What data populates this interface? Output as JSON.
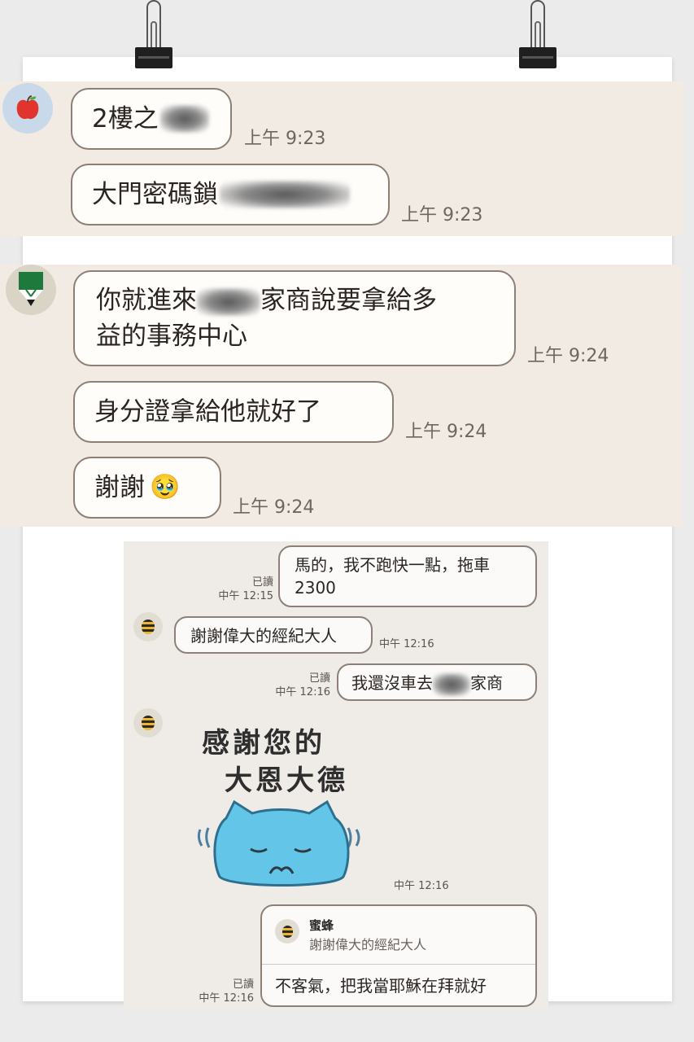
{
  "top_chat": {
    "group1": {
      "messages": [
        {
          "text": "2樓之",
          "time": "上午 9:23"
        },
        {
          "text": "大門密碼鎖",
          "time": "上午 9:23"
        }
      ]
    },
    "group2": {
      "messages": [
        {
          "text_a": "你就進來",
          "text_b": "家商說要拿給多",
          "text_c": "益的事務中心",
          "time": "上午 9:24"
        },
        {
          "text": "身分證拿給他就好了",
          "time": "上午 9:24"
        },
        {
          "text": "謝謝",
          "emoji": "🥹",
          "time": "上午 9:24"
        }
      ]
    }
  },
  "bottom_chat": {
    "msg1": {
      "line1": "馬的，我不跑快一點，拖車",
      "line2": "2300",
      "read": "已讀",
      "time": "中午 12:15"
    },
    "msg2": {
      "text": "謝謝偉大的經紀大人",
      "time": "中午 12:16"
    },
    "msg3": {
      "text_a": "我還沒車去",
      "text_b": "家商",
      "read": "已讀",
      "time": "中午 12:16"
    },
    "sticker": {
      "line1": "感謝您的",
      "line2": "大恩大德",
      "time": "中午 12:16"
    },
    "reply": {
      "quoted_name": "蜜蜂",
      "quoted_text": "謝謝偉大的經紀大人",
      "text": "不客氣，把我當耶穌在拜就好",
      "read": "已讀",
      "time": "中午 12:16"
    }
  },
  "colors": {
    "panel": "#f1ebe4",
    "bubble_border": "#8d7f75",
    "sticker_blue": "#63c6e8"
  },
  "icons": [
    "apple-icon",
    "pencil-icon",
    "bee-icon",
    "binder-clip-icon"
  ]
}
